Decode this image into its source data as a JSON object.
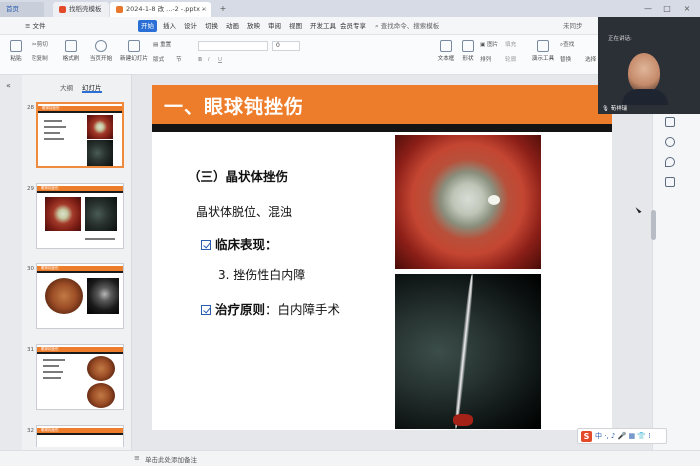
{
  "titlebar": {
    "home_tab": "首页",
    "tab2": "找稻壳模板",
    "tab3": "2024-1-8 改 ...-2 -.pptx - 改",
    "new_tab_label": "+",
    "window_buttons": [
      "—",
      "□",
      "×"
    ]
  },
  "menubar": {
    "file": "≡ 文件",
    "items": [
      "开始",
      "插入",
      "设计",
      "切换",
      "动画",
      "放映",
      "审阅",
      "视图",
      "开发工具",
      "会员专享"
    ],
    "search": "查找命令、搜索模板",
    "share": "未同步"
  },
  "ribbon": {
    "paste": "粘贴",
    "cut": "剪切",
    "copy": "复制",
    "format_painter": "格式刷",
    "from_current": "当页开始",
    "new_slide": "新建幻灯片",
    "layout": "版式",
    "section": "节",
    "reset": "重置",
    "font_name": "",
    "font_size": "0",
    "text_box": "文本框",
    "shape": "形状",
    "arrange": "排列",
    "picture": "图片",
    "fill": "填充",
    "outline": "轮廓",
    "slide_show": "演示工具",
    "replace": "替换",
    "find": "查找",
    "select": "选择"
  },
  "leftpanel": {
    "tab_outline": "大纲",
    "tab_slides": "幻灯片",
    "slides": [
      {
        "num": "28",
        "header": "眼球钝挫伤",
        "selected": true
      },
      {
        "num": "29",
        "header": "眼球钝挫伤",
        "selected": false
      },
      {
        "num": "30",
        "header": "眼球钝挫伤",
        "selected": false
      },
      {
        "num": "31",
        "header": "眼球钝挫伤",
        "selected": false
      },
      {
        "num": "32",
        "header": "眼球钝挫伤",
        "selected": false
      }
    ],
    "add_slide": "+"
  },
  "slide": {
    "title": "一、眼球钝挫伤",
    "heading": "（三）晶状体挫伤",
    "line1": "晶状体脱位、混浊",
    "clinical_label": "临床表现",
    "clinical_colon": "：",
    "clinical_item": "3. 挫伤性白内障",
    "treatment_label": "治疗原则",
    "treatment_text": "：白内障手术"
  },
  "video": {
    "label": "正在讲话:",
    "name": "荀祥瑞"
  },
  "statusbar": {
    "notes": "单击此处添加备注"
  },
  "ime": {
    "logo": "S",
    "text": "中 ·, ♪ 🎤 ▦ 👕 ⁞"
  },
  "colors": {
    "accent_orange": "#ee7d2b",
    "accent_blue": "#2a6fd6",
    "checkbox_blue": "#2a5db0"
  }
}
